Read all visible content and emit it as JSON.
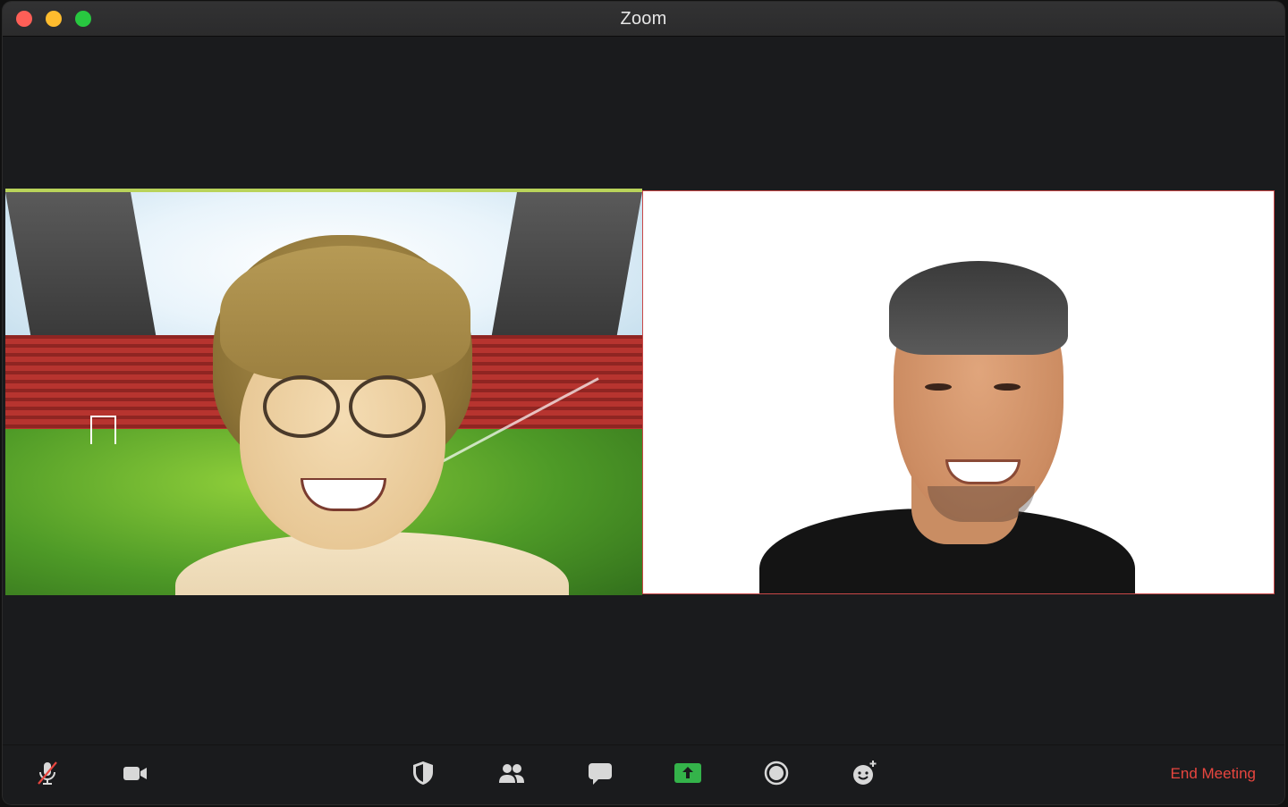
{
  "window": {
    "title": "Zoom"
  },
  "participants": [
    {
      "id": "left",
      "active_speaker": true,
      "background": "stadium"
    },
    {
      "id": "right",
      "active_speaker": false,
      "background": "white"
    }
  ],
  "toolbar": {
    "buttons": [
      {
        "name": "mute",
        "icon": "microphone-muted-icon"
      },
      {
        "name": "video",
        "icon": "video-camera-icon"
      },
      {
        "name": "security",
        "icon": "shield-icon"
      },
      {
        "name": "participants",
        "icon": "people-icon"
      },
      {
        "name": "chat",
        "icon": "chat-bubble-icon"
      },
      {
        "name": "share-screen",
        "icon": "share-screen-icon"
      },
      {
        "name": "record",
        "icon": "record-icon"
      },
      {
        "name": "reactions",
        "icon": "smiley-add-icon"
      }
    ],
    "end_label": "End Meeting"
  },
  "colors": {
    "active_speaker_border": "#b9d35a",
    "share_green": "#34b34a",
    "end_red": "#e8463f"
  }
}
